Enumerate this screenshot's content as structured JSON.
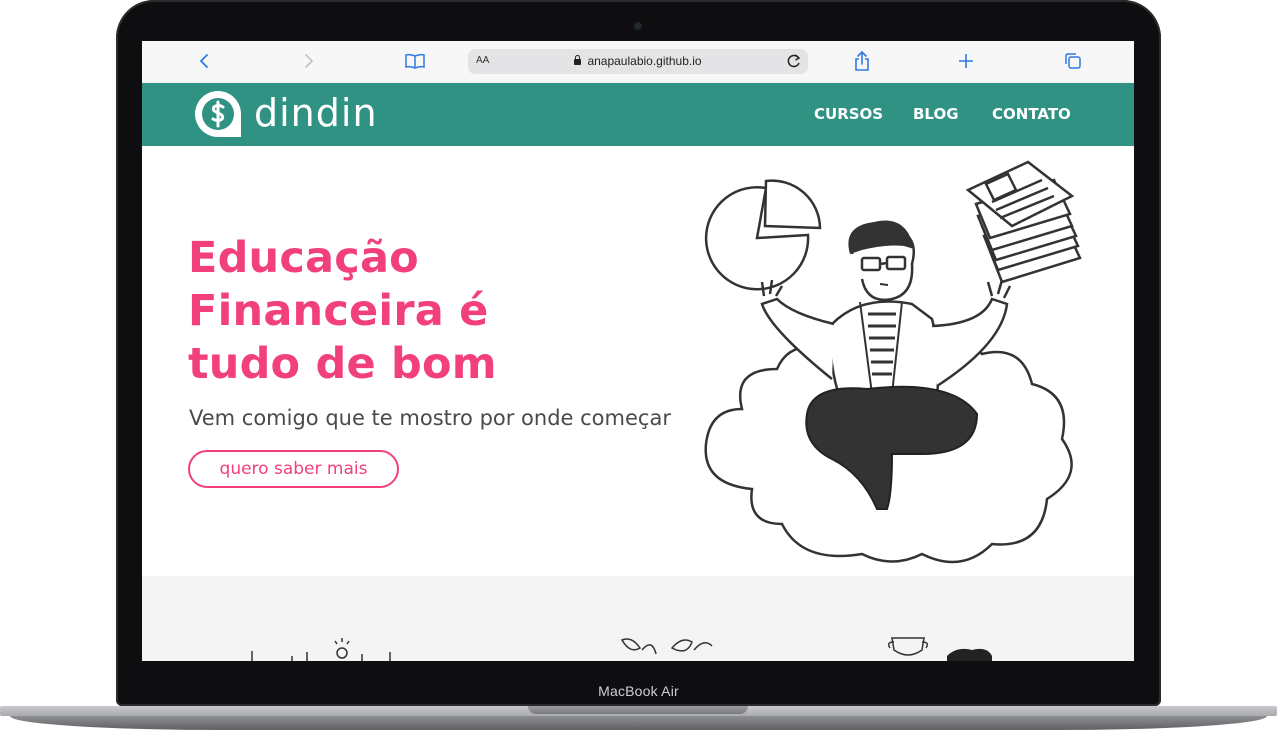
{
  "browser": {
    "text_size_label": "AA",
    "url": "anapaulabio.github.io"
  },
  "site": {
    "logo_text": "dindin",
    "nav": {
      "items": [
        {
          "label": "CURSOS"
        },
        {
          "label": "BLOG"
        },
        {
          "label": "CONTATO"
        }
      ]
    },
    "hero": {
      "headline_line1": "Educação",
      "headline_line2": "Financeira é",
      "headline_line3": "tudo de bom",
      "subtitle": "Vem comigo que te mostro por onde começar",
      "cta_label": "quero saber mais"
    }
  },
  "device": {
    "label": "MacBook Air"
  },
  "colors": {
    "brand_teal": "#2f9283",
    "accent_pink": "#f23f7e",
    "text_gray": "#4a4a4a",
    "section_gray": "#f4f4f4"
  },
  "icons": [
    "back-chevron-icon",
    "forward-chevron-icon",
    "reader-book-icon",
    "lock-icon",
    "reload-icon",
    "share-icon",
    "new-tab-plus-icon",
    "tabs-overview-icon",
    "dollar-chat-logo-icon"
  ]
}
